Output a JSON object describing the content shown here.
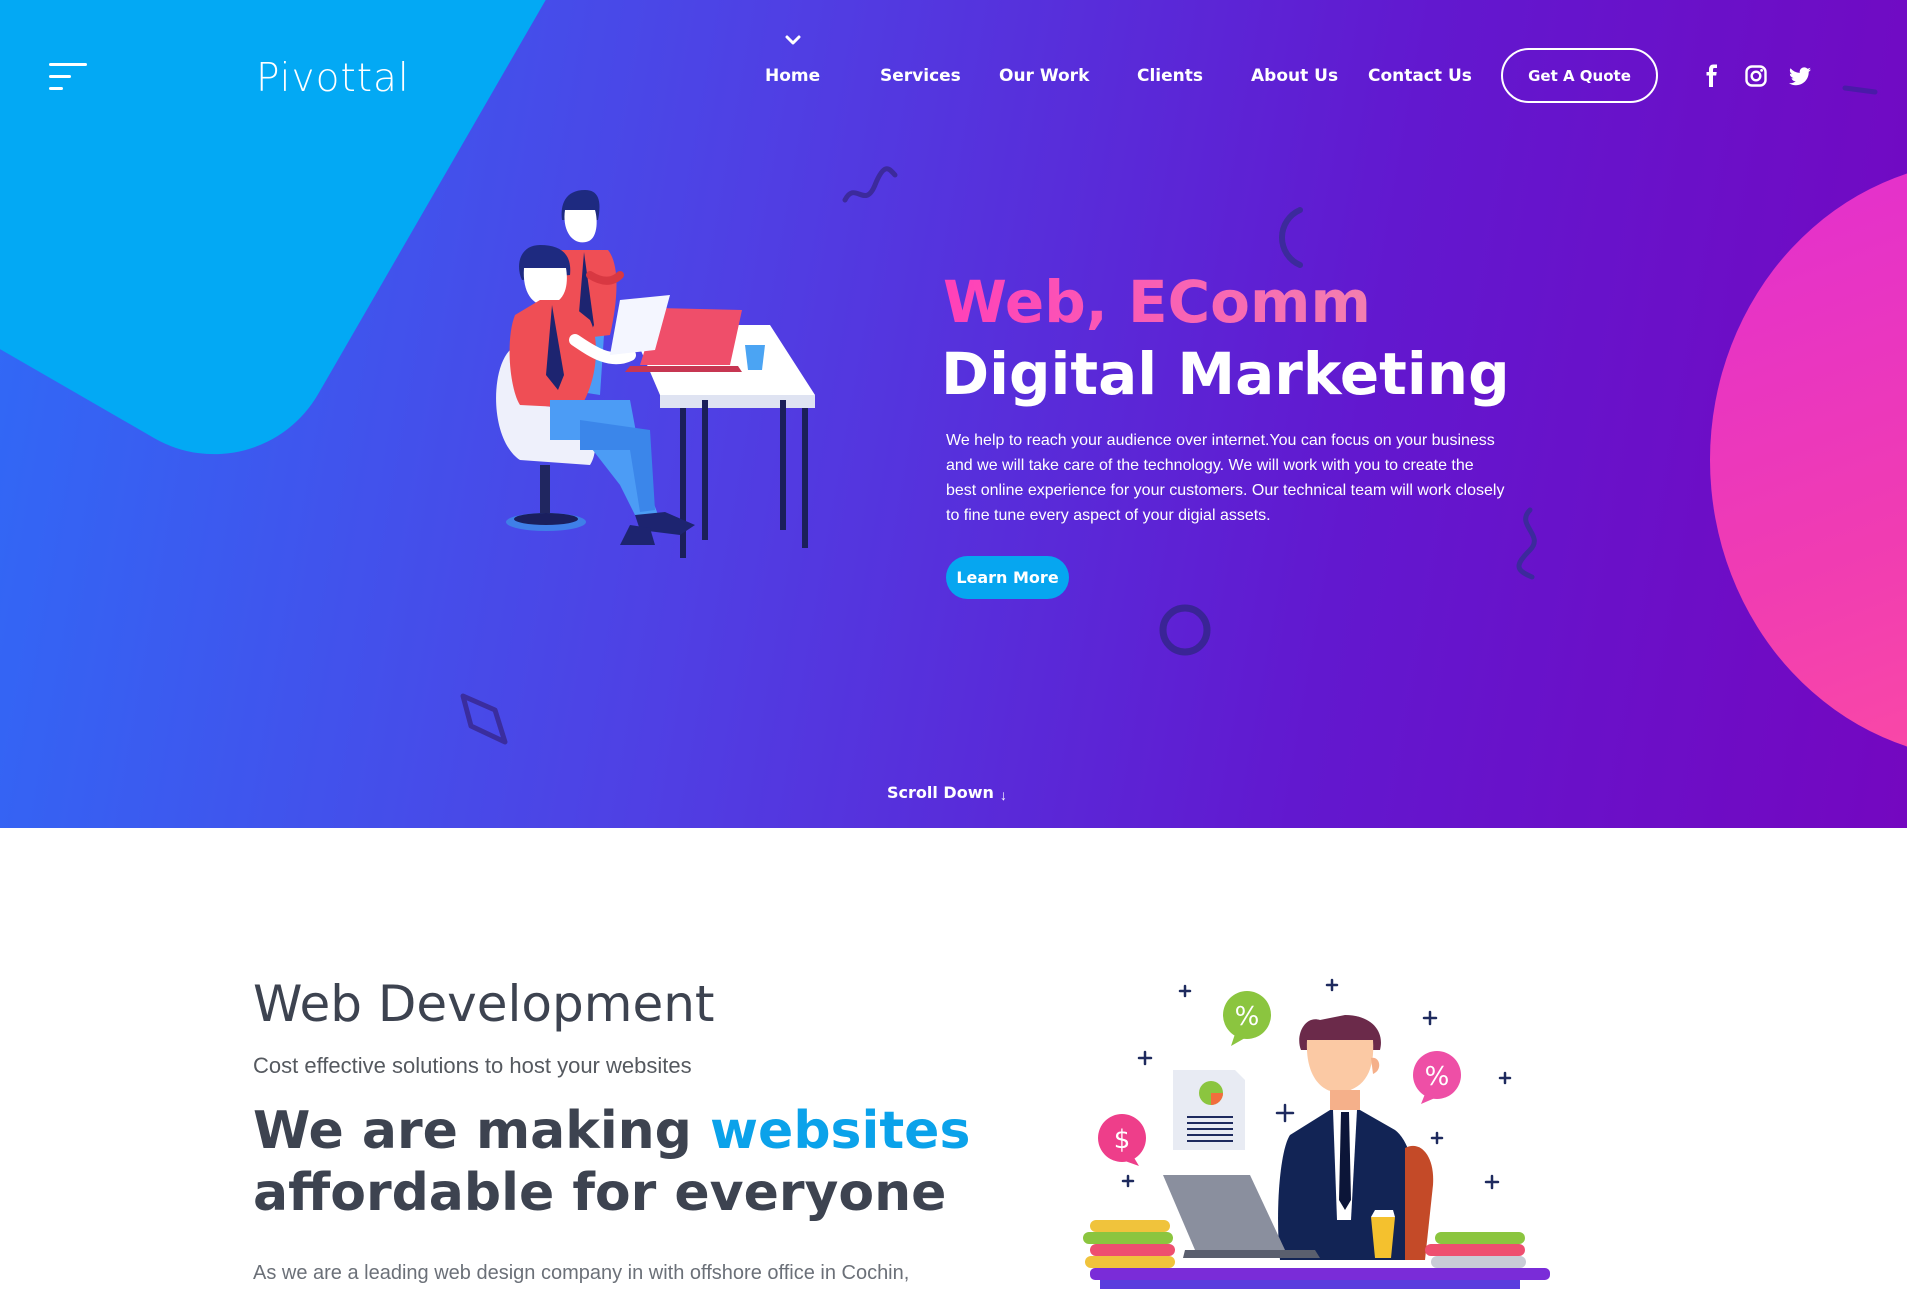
{
  "brand": {
    "logo_text": "Pivottal"
  },
  "nav": {
    "items": [
      "Home",
      "Services",
      "Our Work",
      "Clients",
      "About Us",
      "Contact Us"
    ],
    "active": "Home",
    "quote_label": "Get A Quote"
  },
  "social": [
    "facebook-icon",
    "instagram-icon",
    "twitter-icon"
  ],
  "hero": {
    "title_line1": "Web, EComm",
    "title_line2": "Digital Marketing",
    "description": "We help to reach your audience over internet.You can focus on your business and we will take care of the technology. We will work with you to create the best online experience for your customers. Our technical team will work closely to fine tune every aspect of your digial assets.",
    "cta_label": "Learn More",
    "scroll_label": "Scroll Down"
  },
  "section": {
    "title": "Web Development",
    "subtitle": "Cost effective solutions to host your websites",
    "heading_part1": "We are making ",
    "heading_highlight": "websites",
    "heading_part2": "affordable for everyone",
    "body": "As we are a leading web design company in with offshore office in Cochin,",
    "badge_percent": "%",
    "badge_dollar": "$"
  },
  "colors": {
    "hero_gradient_start": "#2f6bf7",
    "hero_gradient_end": "#7407c0",
    "accent_blue": "#03a9f4",
    "accent_pink": "#f03cb2",
    "highlight": "#0ba2ea",
    "heading_text": "#3d4350"
  }
}
